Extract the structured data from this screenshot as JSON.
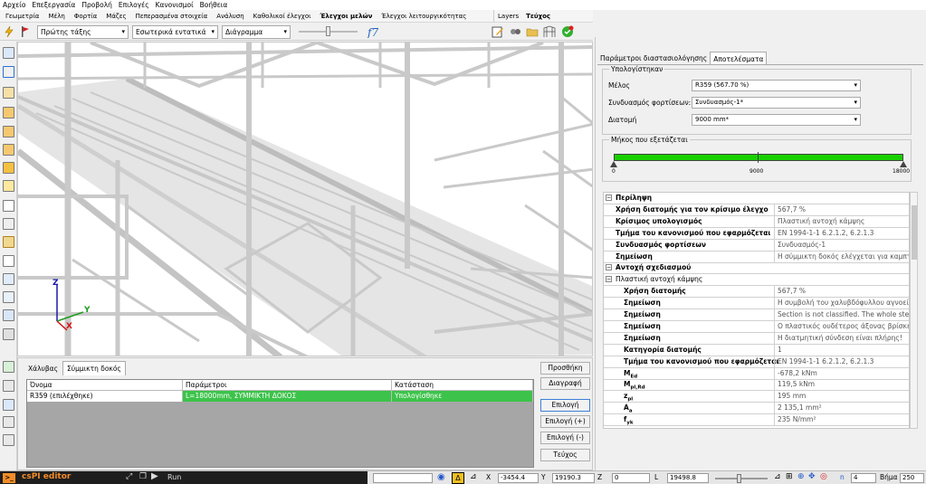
{
  "menu": [
    "Αρχείο",
    "Επεξεργασία",
    "Προβολή",
    "Επιλογές",
    "Κανονισμοί",
    "Βοήθεια"
  ],
  "ribbon_tabs": [
    {
      "label": "Γεωμετρία"
    },
    {
      "label": "Μέλη"
    },
    {
      "label": "Φορτία"
    },
    {
      "label": "Μάζες"
    },
    {
      "label": "Πεπερασμένα στοιχεία"
    },
    {
      "label": "Ανάλυση"
    },
    {
      "label": "Καθολικοί έλεγχοι"
    },
    {
      "label": "Έλεγχοι μελών",
      "active": true
    },
    {
      "label": "Έλεγχοι λειτουργικότητας"
    }
  ],
  "ribbon_tabs_right": [
    {
      "label": "Layers"
    },
    {
      "label": "Τεύχος",
      "active": true
    }
  ],
  "toolbar": {
    "combo_order": "Πρώτης τάξης",
    "combo_forces": "Εσωτερικά εντατικά",
    "combo_view": "Διάγραμμα"
  },
  "viewport": {
    "axis_z": "Z",
    "axis_y": "Y",
    "axis_x": "X",
    "colors": {
      "axis_z": "#1a1aa8",
      "axis_y": "#1f9d1f",
      "axis_x": "#d41111",
      "structure": "#c8c8c8"
    }
  },
  "bottom": {
    "tabs": [
      {
        "label": "Χάλυβας"
      },
      {
        "label": "Σύμμικτη δοκός",
        "active": true
      }
    ],
    "columns": [
      "Όνομα",
      "Παράμετροι",
      "Κατάσταση"
    ],
    "rows": [
      {
        "name": "R359 (επιλέχθηκε)",
        "params": "L=18000mm, ΣΥΜΜΙΚΤΗ ΔΟΚΟΣ",
        "status": "Υπολογίσθηκε"
      }
    ],
    "buttons": {
      "add": "Προσθήκη",
      "delete": "Διαγραφή",
      "select": "Επιλογή",
      "select_plus": "Επιλογή (+)",
      "select_minus": "Επιλογή (-)",
      "report": "Τεύχος"
    }
  },
  "right": {
    "tabs": [
      {
        "label": "Παράμετροι διαστασιολόγησης"
      },
      {
        "label": "Αποτελέσματα",
        "active": true
      }
    ],
    "calc_group": "Υπολογίστηκαν",
    "fields": {
      "member_label": "Μέλος",
      "member_value": "R359 (567.70 %)",
      "combo_label": "Συνδυασμός φορτίσεων:",
      "combo_value": "Συνδυασμός-1*",
      "section_label": "Διατομή",
      "section_value": "9000 mm*"
    },
    "length_group": "Μήκος που εξετάζεται",
    "length_ticks": {
      "start": "0",
      "mid": "9000",
      "end": "18000"
    },
    "bar_color": "#18d000",
    "results": {
      "summary_title": "Περίληψη",
      "summary": [
        {
          "k": "Χρήση διατομής για τον κρίσιμο έλεγχο",
          "v": "567,7 %"
        },
        {
          "k": "Κρίσιμος υπολογισμός",
          "v": "Πλαστική αντοχή κάμψης"
        },
        {
          "k": "Τμήμα του κανονισμού που εφαρμόζεται",
          "v": "EN 1994-1-1  6.2.1.2, 6.2.1.3"
        },
        {
          "k": "Συνδυασμός φορτίσεων",
          "v": "Συνδυασμός-1"
        },
        {
          "k": "Σημείωση",
          "v": "Η σύμμικτη δοκός ελέγχεται για καμπτικ"
        }
      ],
      "design_title": "Αντοχή σχεδιασμού",
      "plastic_title": "Πλαστική αντοχή κάμψης",
      "plastic": [
        {
          "k": "Χρήση διατομής",
          "v": "567,7 %"
        },
        {
          "k": "Σημείωση",
          "v": "Η συμβολή του χαλυβδόφυλλου αγνοείτ"
        },
        {
          "k": "Σημείωση",
          "v": "Section is not classified. The whole steel s"
        },
        {
          "k": "Σημείωση",
          "v": "Ο πλαστικός ουδέτερος άξονας βρίσκετα"
        },
        {
          "k": "Σημείωση",
          "v": "Η διατμητική σύνδεση είναι πλήρης!"
        },
        {
          "k": "Κατηγορία διατομής",
          "v": "1"
        },
        {
          "k": "Τμήμα του κανονισμού που εφαρμόζεται",
          "v": "EN 1994-1-1  6.2.1.2, 6.2.1.3"
        },
        {
          "k": "M",
          "sub": "Ed",
          "v": "-678,2 kNm"
        },
        {
          "k": "M",
          "sub": "pl,Rd",
          "v": "119,5 kNm"
        },
        {
          "k": "z",
          "sub": "pl",
          "v": "195 mm"
        },
        {
          "k": "A",
          "sub": "a",
          "v": "2 135,1 mm²"
        },
        {
          "k": "f",
          "sub": "yk",
          "v": "235 N/mm²"
        }
      ]
    }
  },
  "status": {
    "app": "csPI editor",
    "prompt": ">_",
    "run": "Run",
    "x_label": "X",
    "x_value": "-3454.4",
    "y_label": "Y",
    "y_value": "19190.3",
    "z_label": "Z",
    "z_value": "0",
    "l_label": "L",
    "l_value": "19498.8",
    "n_label": "n",
    "n_value": "4",
    "step_label": "Βήμα",
    "step_value": "250"
  }
}
